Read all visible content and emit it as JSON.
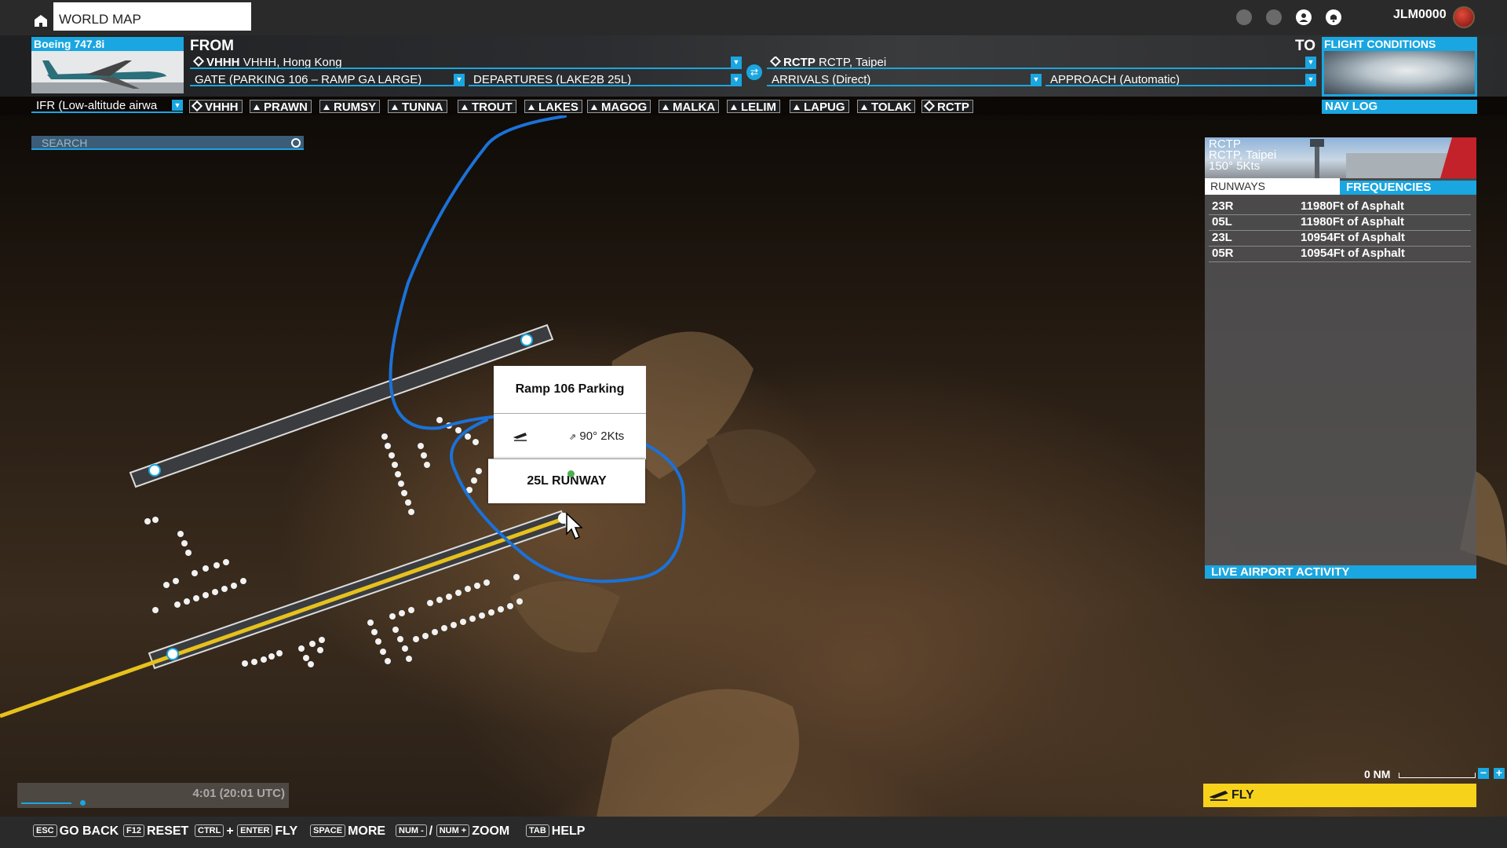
{
  "header": {
    "world_map_label": "WORLD MAP",
    "user_name": "JLM0000",
    "icons": [
      "home-icon",
      "globe-icon",
      "group-icon",
      "profile-icon",
      "notifications-icon"
    ]
  },
  "flight": {
    "aircraft_name": "Boeing 747.8i",
    "from_label": "FROM",
    "to_label": "TO",
    "departure_code": "VHHH",
    "departure_name": "VHHH, Hong Kong",
    "gate": "GATE (PARKING 106 – RAMP GA LARGE)",
    "departures": "DEPARTURES (LAKE2B 25L)",
    "arrival_code": "RCTP",
    "arrival_name": "RCTP, Taipei",
    "arrivals": "ARRIVALS (Direct)",
    "approach": "APPROACH (Automatic)",
    "flight_conditions_label": "FLIGHT CONDITIONS",
    "route_type": "IFR (Low-altitude airwa",
    "nav_log_label": "NAV LOG",
    "waypoints": [
      {
        "name": "VHHH",
        "type": "airport"
      },
      {
        "name": "PRAWN",
        "type": "fix"
      },
      {
        "name": "RUMSY",
        "type": "fix"
      },
      {
        "name": "TUNNA",
        "type": "fix"
      },
      {
        "name": "TROUT",
        "type": "fix"
      },
      {
        "name": "LAKES",
        "type": "fix"
      },
      {
        "name": "MAGOG",
        "type": "fix"
      },
      {
        "name": "MALKA",
        "type": "fix"
      },
      {
        "name": "LELIM",
        "type": "fix"
      },
      {
        "name": "LAPUG",
        "type": "fix"
      },
      {
        "name": "TOLAK",
        "type": "fix"
      },
      {
        "name": "RCTP",
        "type": "airport"
      }
    ]
  },
  "map": {
    "search_placeholder": "SEARCH",
    "popup": {
      "title": "Ramp 106 Parking",
      "wind": "90° 2Kts",
      "runway": "25L RUNWAY"
    }
  },
  "airport_panel": {
    "code": "RCTP",
    "name": "RCTP, Taipei",
    "wind": "150° 5Kts",
    "tab_runways": "RUNWAYS",
    "tab_frequencies": "FREQUENCIES",
    "runways": [
      {
        "id": "23R",
        "desc": "11980Ft of Asphalt"
      },
      {
        "id": "05L",
        "desc": "11980Ft of Asphalt"
      },
      {
        "id": "23L",
        "desc": "10954Ft of Asphalt"
      },
      {
        "id": "05R",
        "desc": "10954Ft of Asphalt"
      }
    ],
    "live_activity_label": "LIVE AIRPORT ACTIVITY"
  },
  "time": {
    "text": "4:01 (20:01 UTC)"
  },
  "scale": {
    "label": "0 NM",
    "zoom_out": "−",
    "zoom_in": "+"
  },
  "fly_label": "FLY",
  "hints": [
    {
      "keys": [
        "ESC"
      ],
      "label": "GO BACK"
    },
    {
      "keys": [
        "F12"
      ],
      "label": "RESET"
    },
    {
      "keys": [
        "CTRL",
        "ENTER"
      ],
      "joiner": "+",
      "label": "FLY"
    },
    {
      "keys": [
        "SPACE"
      ],
      "label": "MORE"
    },
    {
      "keys": [
        "NUM -",
        "NUM +"
      ],
      "joiner": "/",
      "label": "ZOOM"
    },
    {
      "keys": [
        "TAB"
      ],
      "label": "HELP"
    }
  ],
  "colors": {
    "accent": "#1aa6e0",
    "fly": "#f7d21b",
    "route": "#e7c11c",
    "annotation": "#1b72d8"
  }
}
